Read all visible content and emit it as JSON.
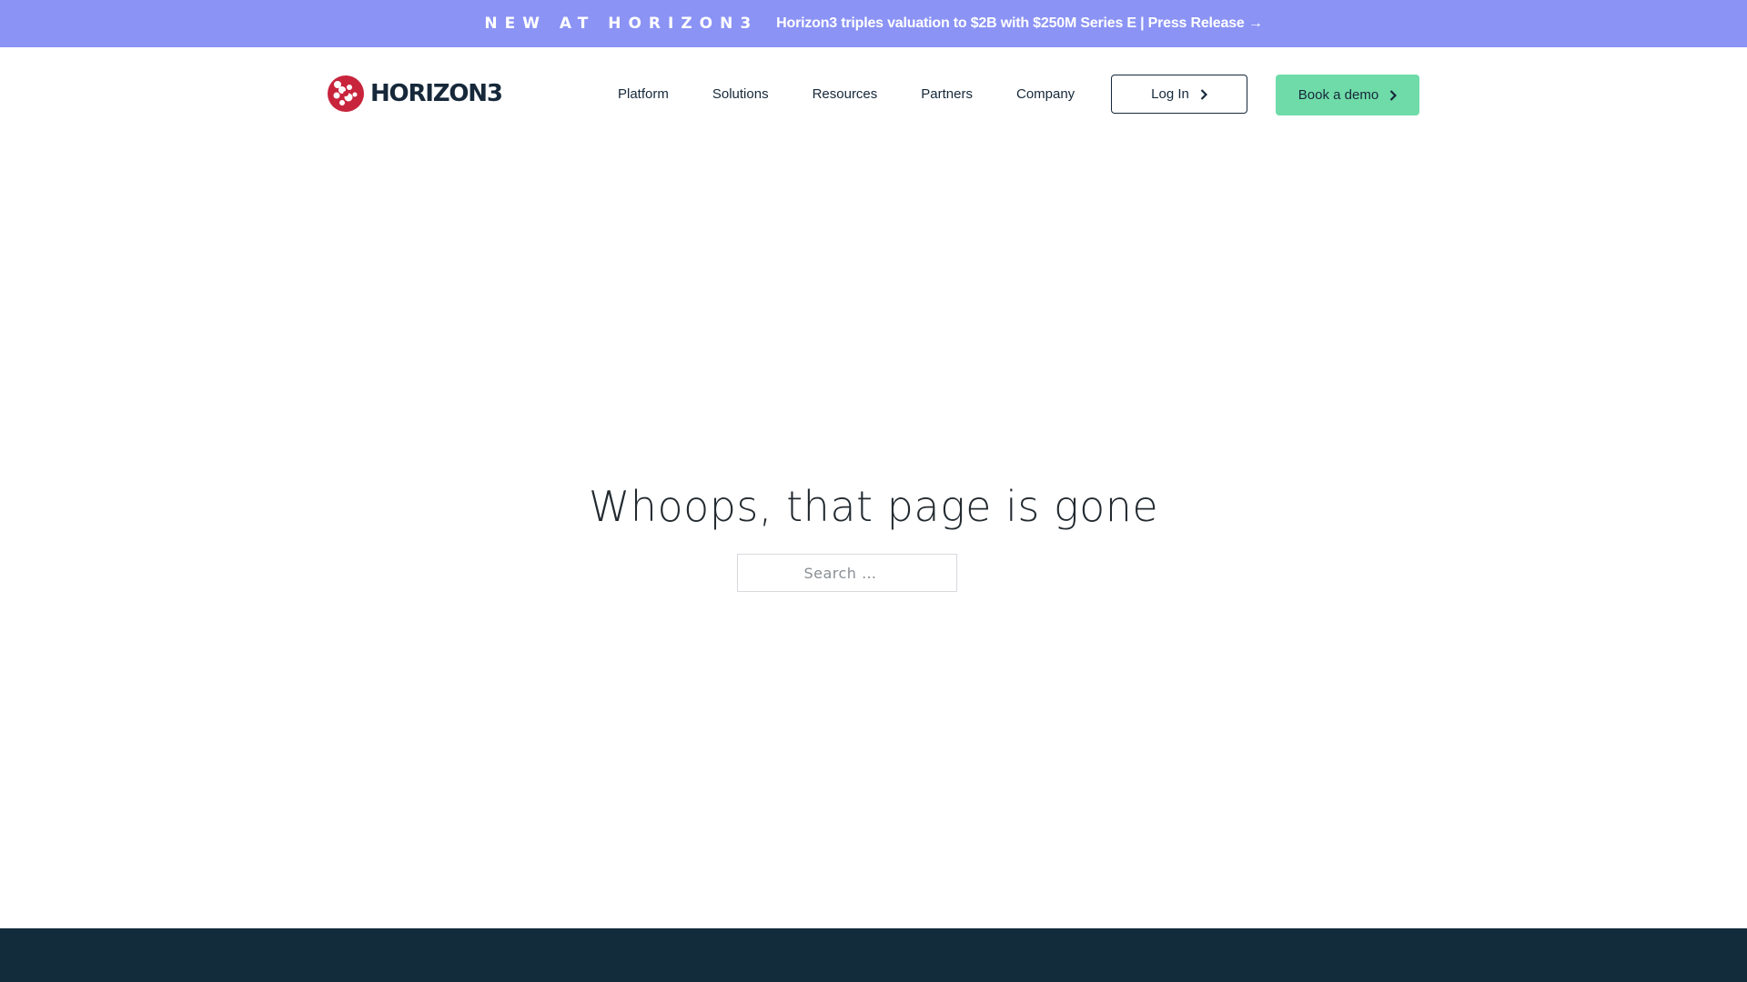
{
  "announcement": {
    "tag": "NEW AT HORIZON3",
    "link_text": "Horizon3 triples valuation to $2B with $250M Series E | Press Release →",
    "background": "#8b93f5"
  },
  "header": {
    "logo_text": "HORIZON3",
    "logo_icon": "horizon3-logo-mark",
    "nav": [
      {
        "label": "Platform"
      },
      {
        "label": "Solutions"
      },
      {
        "label": "Resources"
      },
      {
        "label": "Partners"
      },
      {
        "label": "Company"
      }
    ],
    "login_label": "Log In",
    "demo_label": "Book a demo",
    "accent_color": "#6fdba8",
    "brand_color": "#c8243c"
  },
  "main": {
    "title": "Whoops, that page is gone",
    "search": {
      "placeholder": "Search …",
      "value": ""
    }
  },
  "footer": {
    "background": "#122c3c"
  }
}
